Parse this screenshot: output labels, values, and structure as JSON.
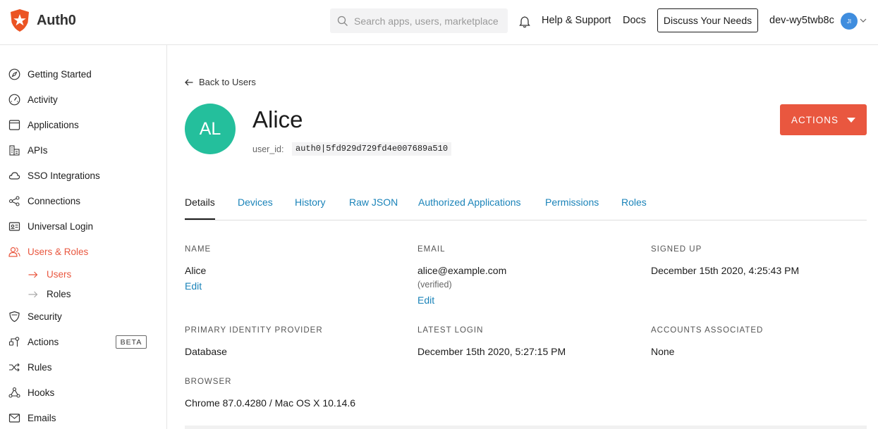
{
  "header": {
    "brand": "Auth0",
    "search_placeholder": "Search apps, users, marketplace",
    "help": "Help & Support",
    "docs": "Docs",
    "discuss": "Discuss Your Needs",
    "tenant": "dev-wy5twb8c",
    "tenant_avatar": "JI"
  },
  "sidebar": {
    "items": [
      {
        "label": "Getting Started",
        "icon": "compass-icon"
      },
      {
        "label": "Activity",
        "icon": "gauge-icon"
      },
      {
        "label": "Applications",
        "icon": "window-icon"
      },
      {
        "label": "APIs",
        "icon": "buildings-icon"
      },
      {
        "label": "SSO Integrations",
        "icon": "cloud-icon"
      },
      {
        "label": "Connections",
        "icon": "share-icon"
      },
      {
        "label": "Universal Login",
        "icon": "id-card-icon"
      },
      {
        "label": "Users & Roles",
        "icon": "users-icon"
      },
      {
        "label": "Security",
        "icon": "shield-icon"
      },
      {
        "label": "Actions",
        "icon": "flow-icon"
      },
      {
        "label": "Rules",
        "icon": "shuffle-icon"
      },
      {
        "label": "Hooks",
        "icon": "hook-icon"
      },
      {
        "label": "Emails",
        "icon": "mail-icon"
      }
    ],
    "sub": [
      {
        "label": "Users"
      },
      {
        "label": "Roles"
      }
    ],
    "beta": "BETA"
  },
  "main": {
    "back": "Back to Users",
    "avatar_initials": "AL",
    "name": "Alice",
    "user_id_label": "user_id:",
    "user_id": "auth0|5fd929d729fd4e007689a510",
    "actions": "ACTIONS",
    "tabs": [
      "Details",
      "Devices",
      "History",
      "Raw JSON",
      "Authorized Applications",
      "Permissions",
      "Roles"
    ],
    "fields": {
      "name_label": "NAME",
      "name_value": "Alice",
      "edit": "Edit",
      "email_label": "EMAIL",
      "email_value": "alice@example.com",
      "email_status": "(verified)",
      "signed_up_label": "SIGNED UP",
      "signed_up_value": "December 15th 2020, 4:25:43 PM",
      "provider_label": "PRIMARY IDENTITY PROVIDER",
      "provider_value": "Database",
      "latest_login_label": "LATEST LOGIN",
      "latest_login_value": "December 15th 2020, 5:27:15 PM",
      "accounts_label": "ACCOUNTS ASSOCIATED",
      "accounts_value": "None",
      "browser_label": "BROWSER",
      "browser_value": "Chrome 87.0.4280 / Mac OS X 10.14.6"
    }
  },
  "colors": {
    "brand": "#e9573f",
    "link": "#1a83b9",
    "avatar": "#24bf9c"
  }
}
